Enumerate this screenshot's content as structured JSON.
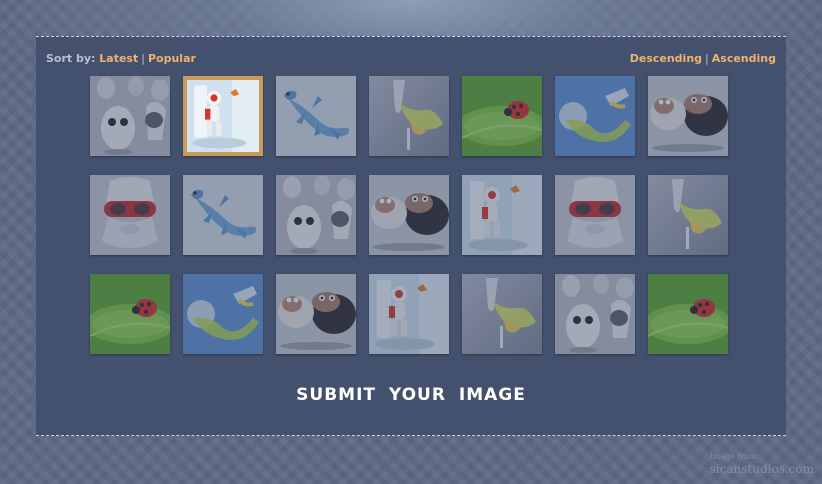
{
  "sort": {
    "label": "Sort by:",
    "options": [
      "Latest",
      "Popular"
    ],
    "separator": "|"
  },
  "order": {
    "options": [
      "Descending",
      "Ascending"
    ],
    "separator": "|"
  },
  "gallery": {
    "selected_index": 1,
    "items": [
      {
        "subject": "egg-robots",
        "icon": "egg-robot-thumbnail-icon"
      },
      {
        "subject": "white-robot",
        "icon": "white-robot-thumbnail-icon"
      },
      {
        "subject": "blue-lizard",
        "icon": "blue-lizard-thumbnail-icon"
      },
      {
        "subject": "glass-splash",
        "icon": "glass-splash-thumbnail-icon"
      },
      {
        "subject": "ladybug-leaf",
        "icon": "ladybug-leaf-thumbnail-icon"
      },
      {
        "subject": "glass-splash-blue",
        "icon": "glass-splash-blue-thumbnail-icon"
      },
      {
        "subject": "sheep",
        "icon": "sheep-thumbnail-icon"
      },
      {
        "subject": "goggles-figure",
        "icon": "goggles-figure-thumbnail-icon"
      },
      {
        "subject": "blue-lizard",
        "icon": "blue-lizard-thumbnail-icon"
      },
      {
        "subject": "egg-robots",
        "icon": "egg-robot-thumbnail-icon"
      },
      {
        "subject": "sheep",
        "icon": "sheep-thumbnail-icon"
      },
      {
        "subject": "white-robot",
        "icon": "white-robot-thumbnail-icon"
      },
      {
        "subject": "goggles-figure",
        "icon": "goggles-figure-thumbnail-icon"
      },
      {
        "subject": "glass-splash",
        "icon": "glass-splash-thumbnail-icon"
      },
      {
        "subject": "ladybug-leaf",
        "icon": "ladybug-leaf-thumbnail-icon"
      },
      {
        "subject": "glass-splash-blue",
        "icon": "glass-splash-blue-thumbnail-icon"
      },
      {
        "subject": "sheep",
        "icon": "sheep-thumbnail-icon"
      },
      {
        "subject": "white-robot",
        "icon": "white-robot-thumbnail-icon"
      },
      {
        "subject": "glass-splash",
        "icon": "glass-splash-thumbnail-icon"
      },
      {
        "subject": "egg-robots",
        "icon": "egg-robot-thumbnail-icon"
      },
      {
        "subject": "ladybug-leaf",
        "icon": "ladybug-leaf-thumbnail-icon"
      }
    ]
  },
  "submit_label": "SUBMIT YOUR IMAGE",
  "credit": {
    "line1": "Image from",
    "line2": "sicanstudios.com"
  },
  "colors": {
    "panel": "#43516f",
    "link": "#f0b26a",
    "selected_border": "#c89a5e",
    "label": "#b7c0d0"
  }
}
